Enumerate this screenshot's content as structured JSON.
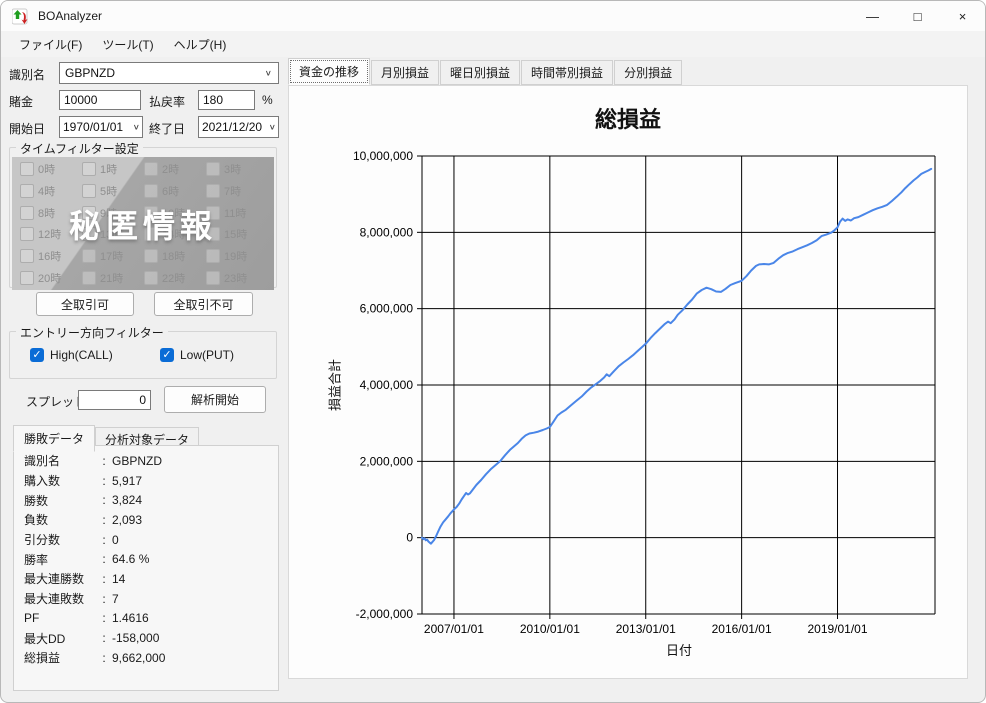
{
  "window": {
    "title": "BOAnalyzer",
    "controls": {
      "minimize": "—",
      "maximize": "□",
      "close": "×"
    }
  },
  "icons": {
    "combo_chevron": "∨",
    "check": "✓"
  },
  "menu": {
    "items": [
      "ファイル(F)",
      "ツール(T)",
      "ヘルプ(H)"
    ]
  },
  "controls": {
    "identifier_label": "識別名",
    "identifier_value": "GBPNZD",
    "bet_label": "賭金",
    "bet_value": "10000",
    "payout_label": "払戻率",
    "payout_value": "180",
    "payout_unit": "%",
    "start_label": "開始日",
    "start_value": "1970/01/01",
    "end_label": "終了日",
    "end_value": "2021/12/20",
    "time_filter": {
      "title": "タイムフィルター設定",
      "watermark": "秘匿情報",
      "hours": [
        "0時",
        "1時",
        "2時",
        "3時",
        "4時",
        "5時",
        "6時",
        "7時",
        "8時",
        "9時",
        "10時",
        "11時",
        "12時",
        "13時",
        "14時",
        "15時",
        "16時",
        "17時",
        "18時",
        "19時",
        "20時",
        "21時",
        "22時",
        "23時"
      ]
    },
    "enable_all_button": "全取引可",
    "disable_all_button": "全取引不可",
    "entry_filter": {
      "title": "エントリー方向フィルター",
      "high_label": "High(CALL)",
      "low_label": "Low(PUT)"
    },
    "spread_label": "スプレッド",
    "spread_value": "0",
    "analyze_button": "解析開始"
  },
  "stats": {
    "tabs": [
      "勝敗データ",
      "分析対象データ"
    ],
    "colon": ":",
    "rows": [
      {
        "label": "識別名",
        "value": "GBPNZD"
      },
      {
        "label": "購入数",
        "value": "5,917"
      },
      {
        "label": "勝数",
        "value": "3,824"
      },
      {
        "label": "負数",
        "value": "2,093"
      },
      {
        "label": "引分数",
        "value": "0"
      },
      {
        "label": "勝率",
        "value": "64.6 %"
      },
      {
        "label": "最大連勝数",
        "value": "14"
      },
      {
        "label": "最大連敗数",
        "value": "7"
      },
      {
        "label": "PF",
        "value": "1.4616"
      },
      {
        "label": "最大DD",
        "value": "-158,000"
      },
      {
        "label": "総損益",
        "value": "9,662,000"
      }
    ]
  },
  "chart_tabs": [
    "資金の推移",
    "月別損益",
    "曜日別損益",
    "時間帯別損益",
    "分別損益"
  ],
  "chart_data": {
    "type": "line",
    "title": "総損益",
    "xlabel": "日付",
    "ylabel": "損益合計",
    "grid": true,
    "line_color": "#4a86e8",
    "xlim": [
      2006.0,
      2022.05
    ],
    "ylim": [
      -2000000,
      10000000
    ],
    "x_ticks": [
      {
        "v": 2007,
        "label": "2007/01/01"
      },
      {
        "v": 2010,
        "label": "2010/01/01"
      },
      {
        "v": 2013,
        "label": "2013/01/01"
      },
      {
        "v": 2016,
        "label": "2016/01/01"
      },
      {
        "v": 2019,
        "label": "2019/01/01"
      }
    ],
    "y_ticks": [
      {
        "v": 10000000,
        "label": "10,000,000"
      },
      {
        "v": 8000000,
        "label": "8,000,000"
      },
      {
        "v": 6000000,
        "label": "6,000,000"
      },
      {
        "v": 4000000,
        "label": "4,000,000"
      },
      {
        "v": 2000000,
        "label": "2,000,000"
      },
      {
        "v": 0,
        "label": "0"
      },
      {
        "v": -2000000,
        "label": "-2,000,000"
      }
    ],
    "series": [
      {
        "name": "損益合計",
        "points": [
          [
            2006.0,
            0
          ],
          [
            2006.04,
            -40000
          ],
          [
            2006.08,
            -20000
          ],
          [
            2006.12,
            -70000
          ],
          [
            2006.16,
            -50000
          ],
          [
            2006.2,
            -100000
          ],
          [
            2006.24,
            -130000
          ],
          [
            2006.28,
            -158000
          ],
          [
            2006.32,
            -120000
          ],
          [
            2006.38,
            -60000
          ],
          [
            2006.44,
            40000
          ],
          [
            2006.5,
            150000
          ],
          [
            2006.58,
            290000
          ],
          [
            2006.66,
            400000
          ],
          [
            2006.74,
            480000
          ],
          [
            2006.82,
            560000
          ],
          [
            2006.9,
            650000
          ],
          [
            2007.0,
            740000
          ],
          [
            2007.08,
            800000
          ],
          [
            2007.16,
            890000
          ],
          [
            2007.24,
            1000000
          ],
          [
            2007.32,
            1100000
          ],
          [
            2007.38,
            1170000
          ],
          [
            2007.44,
            1130000
          ],
          [
            2007.5,
            1160000
          ],
          [
            2007.58,
            1250000
          ],
          [
            2007.7,
            1380000
          ],
          [
            2007.85,
            1510000
          ],
          [
            2008.0,
            1660000
          ],
          [
            2008.15,
            1790000
          ],
          [
            2008.3,
            1900000
          ],
          [
            2008.45,
            2010000
          ],
          [
            2008.6,
            2160000
          ],
          [
            2008.75,
            2300000
          ],
          [
            2008.9,
            2410000
          ],
          [
            2009.0,
            2480000
          ],
          [
            2009.12,
            2590000
          ],
          [
            2009.24,
            2680000
          ],
          [
            2009.36,
            2730000
          ],
          [
            2009.5,
            2750000
          ],
          [
            2009.64,
            2780000
          ],
          [
            2009.78,
            2820000
          ],
          [
            2009.9,
            2860000
          ],
          [
            2010.0,
            2900000
          ],
          [
            2010.12,
            3050000
          ],
          [
            2010.24,
            3200000
          ],
          [
            2010.36,
            3280000
          ],
          [
            2010.5,
            3350000
          ],
          [
            2010.65,
            3460000
          ],
          [
            2010.82,
            3580000
          ],
          [
            2011.0,
            3700000
          ],
          [
            2011.15,
            3830000
          ],
          [
            2011.3,
            3940000
          ],
          [
            2011.45,
            4030000
          ],
          [
            2011.58,
            4110000
          ],
          [
            2011.7,
            4200000
          ],
          [
            2011.78,
            4280000
          ],
          [
            2011.86,
            4230000
          ],
          [
            2012.0,
            4360000
          ],
          [
            2012.15,
            4490000
          ],
          [
            2012.3,
            4590000
          ],
          [
            2012.45,
            4680000
          ],
          [
            2012.6,
            4780000
          ],
          [
            2012.8,
            4930000
          ],
          [
            2013.0,
            5080000
          ],
          [
            2013.15,
            5230000
          ],
          [
            2013.3,
            5360000
          ],
          [
            2013.45,
            5480000
          ],
          [
            2013.6,
            5600000
          ],
          [
            2013.7,
            5660000
          ],
          [
            2013.78,
            5620000
          ],
          [
            2013.9,
            5720000
          ],
          [
            2014.0,
            5840000
          ],
          [
            2014.15,
            5960000
          ],
          [
            2014.3,
            6110000
          ],
          [
            2014.45,
            6240000
          ],
          [
            2014.6,
            6400000
          ],
          [
            2014.75,
            6490000
          ],
          [
            2014.9,
            6550000
          ],
          [
            2015.05,
            6510000
          ],
          [
            2015.2,
            6450000
          ],
          [
            2015.35,
            6440000
          ],
          [
            2015.5,
            6520000
          ],
          [
            2015.65,
            6620000
          ],
          [
            2015.8,
            6670000
          ],
          [
            2016.0,
            6730000
          ],
          [
            2016.15,
            6850000
          ],
          [
            2016.3,
            7000000
          ],
          [
            2016.45,
            7120000
          ],
          [
            2016.55,
            7160000
          ],
          [
            2016.7,
            7170000
          ],
          [
            2016.85,
            7160000
          ],
          [
            2017.0,
            7200000
          ],
          [
            2017.15,
            7310000
          ],
          [
            2017.3,
            7400000
          ],
          [
            2017.45,
            7460000
          ],
          [
            2017.6,
            7500000
          ],
          [
            2017.75,
            7560000
          ],
          [
            2017.9,
            7610000
          ],
          [
            2018.05,
            7660000
          ],
          [
            2018.2,
            7720000
          ],
          [
            2018.35,
            7790000
          ],
          [
            2018.5,
            7900000
          ],
          [
            2018.65,
            7940000
          ],
          [
            2018.8,
            7990000
          ],
          [
            2018.9,
            8050000
          ],
          [
            2019.0,
            8130000
          ],
          [
            2019.08,
            8280000
          ],
          [
            2019.16,
            8360000
          ],
          [
            2019.24,
            8300000
          ],
          [
            2019.32,
            8340000
          ],
          [
            2019.42,
            8310000
          ],
          [
            2019.52,
            8370000
          ],
          [
            2019.65,
            8400000
          ],
          [
            2019.8,
            8460000
          ],
          [
            2019.95,
            8520000
          ],
          [
            2020.1,
            8580000
          ],
          [
            2020.25,
            8630000
          ],
          [
            2020.4,
            8670000
          ],
          [
            2020.55,
            8720000
          ],
          [
            2020.7,
            8820000
          ],
          [
            2020.85,
            8930000
          ],
          [
            2021.0,
            9050000
          ],
          [
            2021.12,
            9160000
          ],
          [
            2021.25,
            9260000
          ],
          [
            2021.38,
            9360000
          ],
          [
            2021.5,
            9440000
          ],
          [
            2021.62,
            9530000
          ],
          [
            2021.74,
            9580000
          ],
          [
            2021.84,
            9620000
          ],
          [
            2021.93,
            9662000
          ]
        ]
      }
    ]
  }
}
